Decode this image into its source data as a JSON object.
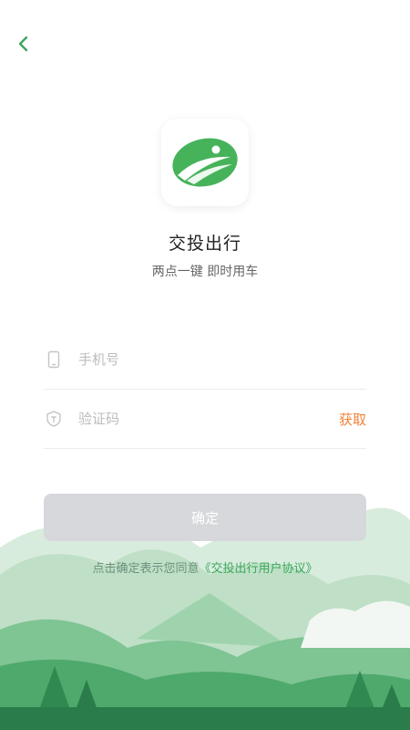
{
  "app": {
    "name": "交投出行",
    "slogan": "两点一键 即时用车"
  },
  "form": {
    "phone_placeholder": "手机号",
    "code_placeholder": "验证码",
    "get_code_label": "获取",
    "confirm_label": "确定"
  },
  "agreement": {
    "prefix": "点击确定表示您同意",
    "link": "《交投出行用户协议》"
  },
  "icons": {
    "back": "chevron-left-icon",
    "phone": "phone-icon",
    "shield": "shield-icon",
    "logo": "app-logo-icon"
  },
  "colors": {
    "accent": "#3ba75b",
    "get_code": "#f08236",
    "button_disabled": "#d6d8db"
  }
}
